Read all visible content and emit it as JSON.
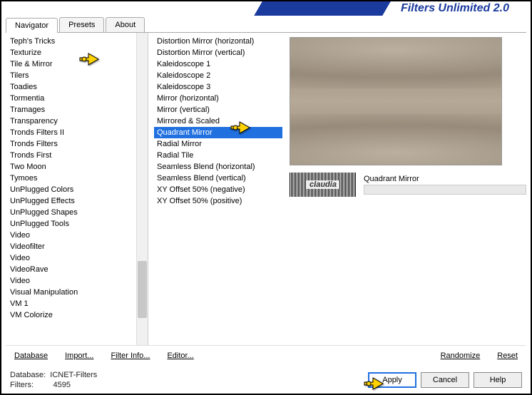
{
  "title": "Filters Unlimited 2.0",
  "tabs": [
    "Navigator",
    "Presets",
    "About"
  ],
  "activeTab": 0,
  "categories": [
    "Teph's Tricks",
    "Texturize",
    "Tile & Mirror",
    "Tilers",
    "Toadies",
    "Tormentia",
    "Tramages",
    "Transparency",
    "Tronds Filters II",
    "Tronds Filters",
    "Tronds First",
    "Two Moon",
    "Tymoes",
    "UnPlugged Colors",
    "UnPlugged Effects",
    "UnPlugged Shapes",
    "UnPlugged Tools",
    "Video",
    "Videofilter",
    "Video",
    "VideoRave",
    "Video",
    "Visual Manipulation",
    "VM 1",
    "VM Colorize"
  ],
  "filters": [
    "Distortion Mirror (horizontal)",
    "Distortion Mirror (vertical)",
    "Kaleidoscope 1",
    "Kaleidoscope 2",
    "Kaleidoscope 3",
    "Mirror (horizontal)",
    "Mirror (vertical)",
    "Mirrored & Scaled",
    "Quadrant Mirror",
    "Radial Mirror",
    "Radial Tile",
    "Seamless Blend (horizontal)",
    "Seamless Blend (vertical)",
    "XY Offset 50% (negative)",
    "XY Offset 50% (positive)"
  ],
  "selectedFilterIndex": 8,
  "currentFilterName": "Quadrant Mirror",
  "watermark": "claudia",
  "linkButtons": {
    "database": "Database",
    "import": "Import...",
    "filterInfo": "Filter Info...",
    "editor": "Editor...",
    "randomize": "Randomize",
    "reset": "Reset"
  },
  "footer": {
    "databaseLabel": "Database:",
    "databaseValue": "ICNET-Filters",
    "filtersLabel": "Filters:",
    "filtersValue": "4595"
  },
  "buttons": {
    "apply": "Apply",
    "cancel": "Cancel",
    "help": "Help"
  }
}
